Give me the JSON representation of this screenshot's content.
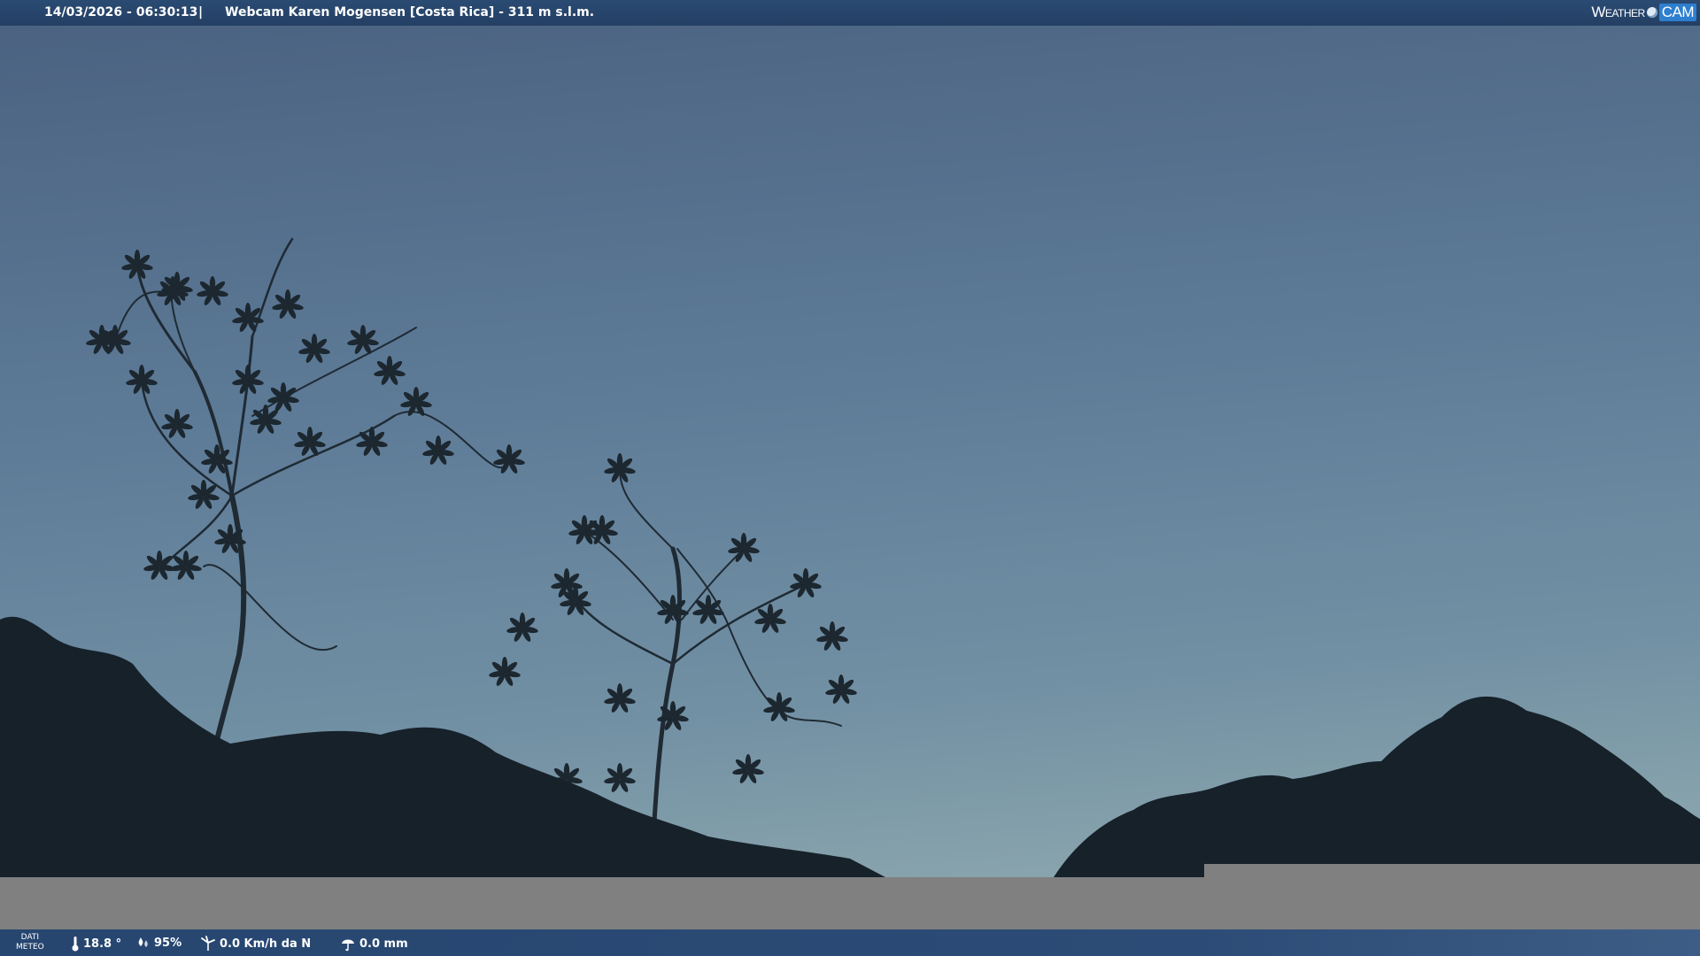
{
  "header": {
    "datetime": "14/03/2026 - 06:30:13",
    "separator": "|",
    "title": "Webcam Karen Mogensen [Costa Rica]  - 311 m s.l.m."
  },
  "brand": {
    "part1": "Weather",
    "part2": "CAM"
  },
  "weather": {
    "label_line1": "DATI",
    "label_line2": "METEO",
    "temperature": "18.8 °",
    "humidity": "95%",
    "wind": "0.0 Km/h da N",
    "rain": "0.0 mm"
  },
  "colors": {
    "sky_top": "#4c6482",
    "sky_bottom": "#7b97a8",
    "header_bg": "#27476e",
    "overlay_gray": "#808080"
  }
}
